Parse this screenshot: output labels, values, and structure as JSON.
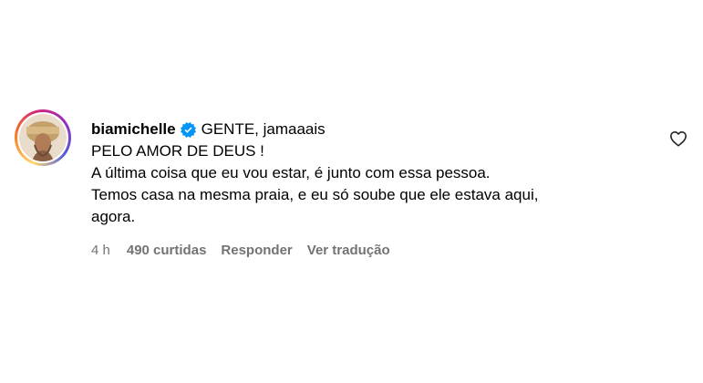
{
  "comment": {
    "username": "biamichelle",
    "verified": true,
    "lines": [
      "GENTE, jamaaais",
      "PELO AMOR DE DEUS !",
      "A última coisa que eu vou estar, é junto com essa pessoa.",
      "Temos casa na mesma praia, e eu só soube que ele estava aqui,",
      "agora."
    ],
    "meta": {
      "time": "4 h",
      "likes": "490 curtidas",
      "reply_label": "Responder",
      "translate_label": "Ver tradução"
    }
  },
  "icons": {
    "verified": "verified-badge-icon",
    "like": "heart-outline-icon"
  },
  "colors": {
    "verified_blue": "#0095f6",
    "meta_gray": "#737373",
    "text": "#000000"
  }
}
